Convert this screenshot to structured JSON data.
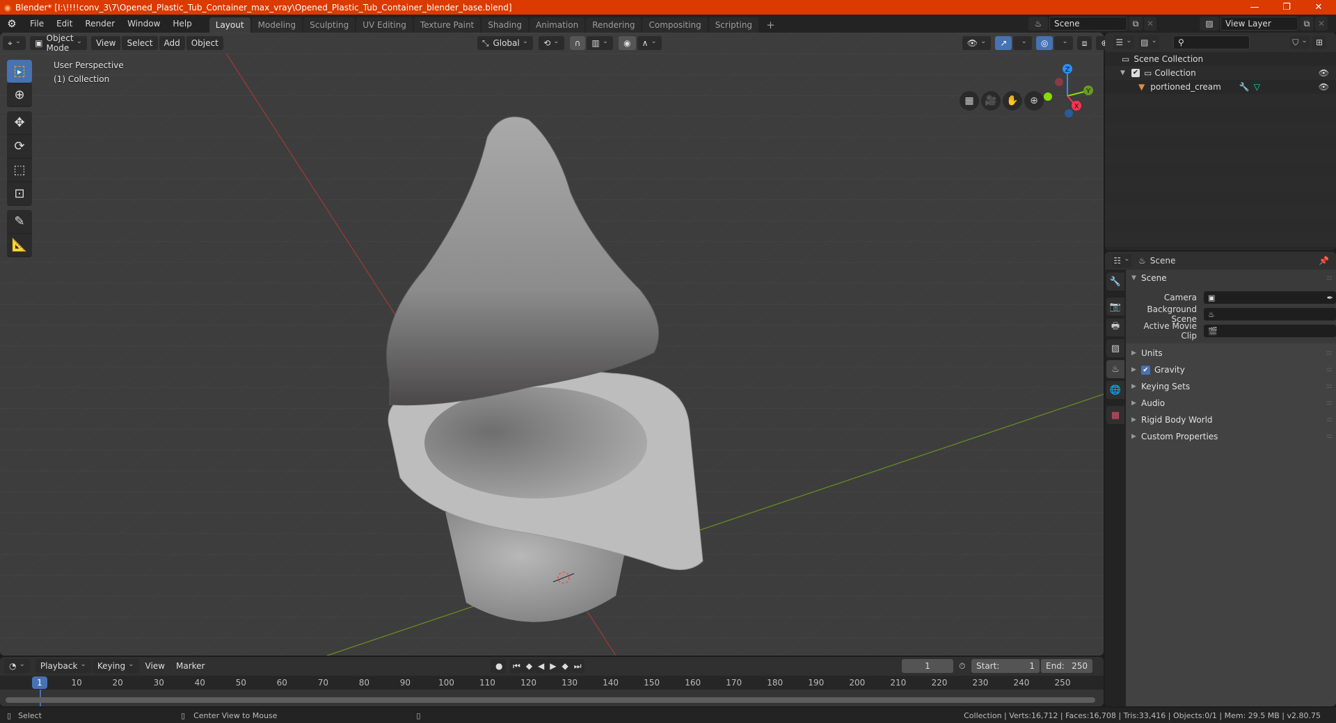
{
  "window": {
    "title": "Blender* [I:\\!!!!conv_3\\7\\Opened_Plastic_Tub_Container_max_vray\\Opened_Plastic_Tub_Container_blender_base.blend]",
    "minimize": "—",
    "maximize": "❐",
    "close": "✕"
  },
  "menubar": {
    "items": [
      "File",
      "Edit",
      "Render",
      "Window",
      "Help"
    ]
  },
  "workspaces": {
    "tabs": [
      "Layout",
      "Modeling",
      "Sculpting",
      "UV Editing",
      "Texture Paint",
      "Shading",
      "Animation",
      "Rendering",
      "Compositing",
      "Scripting"
    ],
    "active": "Layout",
    "add": "+"
  },
  "scene_selector": {
    "value": "Scene"
  },
  "view_layer_selector": {
    "value": "View Layer"
  },
  "viewport": {
    "header": {
      "mode": "Object Mode",
      "menus": [
        "View",
        "Select",
        "Add",
        "Object"
      ],
      "transform_orientation": "Global"
    },
    "overlay_text": {
      "view_name": "User Perspective",
      "collection": "(1) Collection"
    },
    "gizmo_axes": {
      "x": "X",
      "y": "Y",
      "z": "Z"
    },
    "colors": {
      "x_axis": "#ff3352",
      "y_axis": "#8bdc00",
      "z_axis": "#2890ff",
      "grid_bg": "#3d3d3d",
      "accent": "#4772b3"
    }
  },
  "outliner": {
    "search_placeholder": "",
    "rows": [
      {
        "label": "Scene Collection",
        "icon": "scene-collection-icon"
      },
      {
        "label": "Collection",
        "icon": "collection-icon",
        "checked": true,
        "visible": true
      },
      {
        "label": "portioned_cream",
        "icon": "mesh-object-icon",
        "visible": true
      }
    ]
  },
  "properties": {
    "context": "Scene",
    "panels": {
      "scene": {
        "title": "Scene",
        "fields": [
          {
            "label": "Camera",
            "value": ""
          },
          {
            "label": "Background Scene",
            "value": ""
          },
          {
            "label": "Active Movie Clip",
            "value": ""
          }
        ]
      },
      "collapsed": [
        {
          "label": "Units"
        },
        {
          "label": "Gravity",
          "checkbox": true
        },
        {
          "label": "Keying Sets"
        },
        {
          "label": "Audio"
        },
        {
          "label": "Rigid Body World"
        },
        {
          "label": "Custom Properties"
        }
      ]
    }
  },
  "timeline": {
    "menus": [
      "Playback",
      "Keying",
      "View",
      "Marker"
    ],
    "current_frame": "1",
    "start_label": "Start:",
    "start": "1",
    "end_label": "End:",
    "end": "250",
    "ruler_ticks": [
      "10",
      "20",
      "30",
      "40",
      "50",
      "60",
      "70",
      "80",
      "90",
      "100",
      "110",
      "120",
      "130",
      "140",
      "150",
      "160",
      "170",
      "180",
      "190",
      "200",
      "210",
      "220",
      "230",
      "240",
      "250"
    ],
    "playhead_frame": "1"
  },
  "statusbar": {
    "left_action": "Select",
    "middle_action": "Center View to Mouse",
    "stats": "Collection | Verts:16,712 | Faces:16,708 | Tris:33,416 | Objects:0/1 | Mem: 29.5 MB | v2.80.75"
  }
}
